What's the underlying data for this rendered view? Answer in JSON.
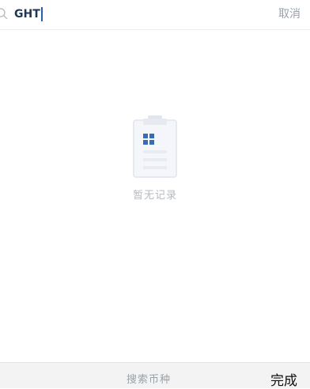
{
  "search": {
    "value": "GHT",
    "cancel_label": "取消"
  },
  "empty_state": {
    "message": "暂无记录"
  },
  "keyboard_bar": {
    "placeholder": "搜索币种",
    "done_label": "完成"
  },
  "colors": {
    "input_text": "#1f3655",
    "caret": "#2b5fae",
    "muted_text": "#9aa1aa",
    "icon_accent": "#3a6cb5"
  },
  "icons": {
    "search": "search-icon",
    "empty": "clipboard-empty-icon"
  }
}
